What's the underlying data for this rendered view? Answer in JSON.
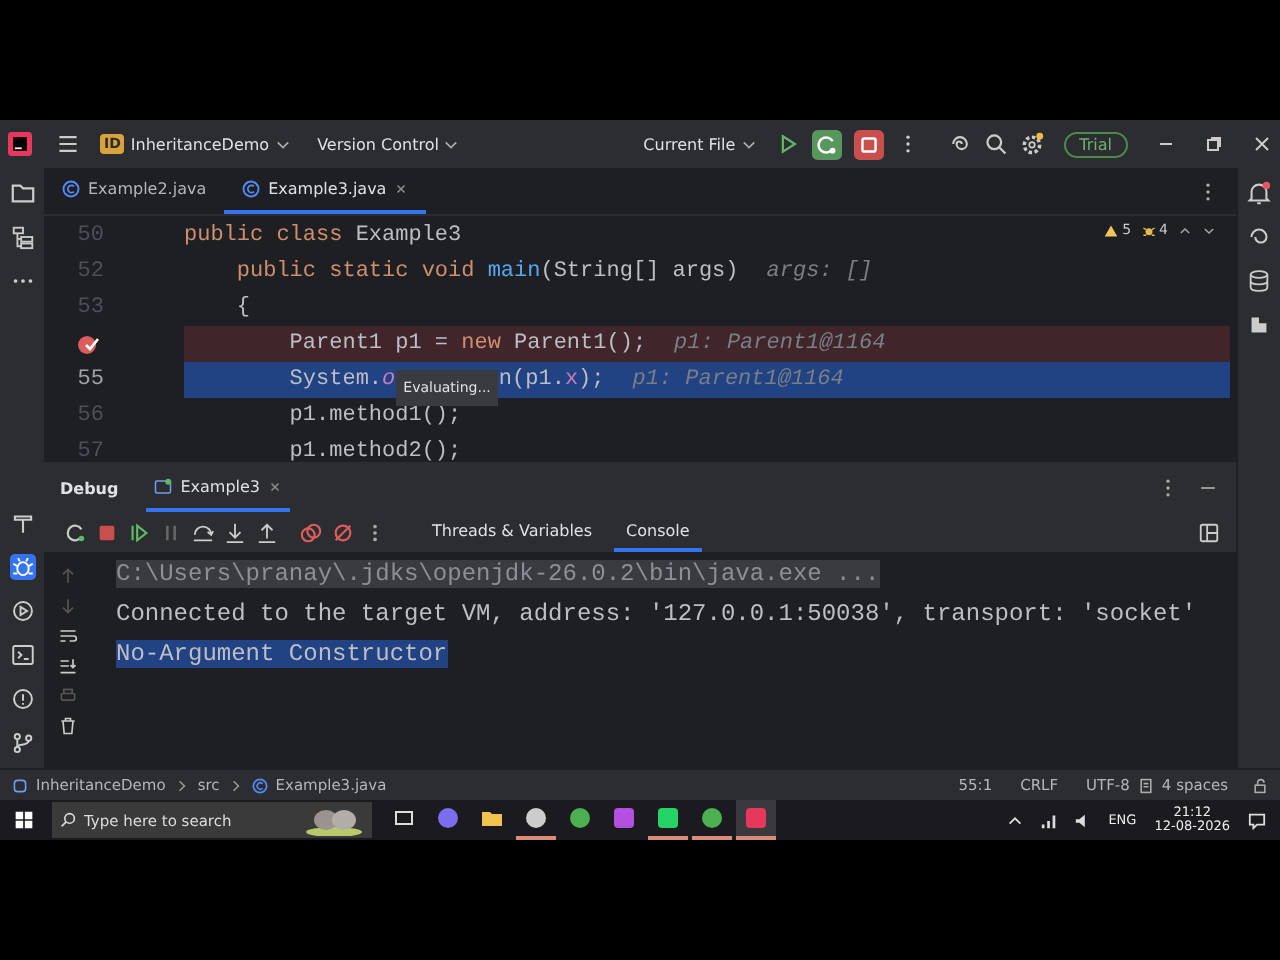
{
  "title_bar": {
    "project_badge": "ID",
    "project": "InheritanceDemo",
    "version_control": "Version Control",
    "run_config": "Current File",
    "trial": "Trial"
  },
  "editor_tabs": [
    {
      "label": "Example2.java",
      "selected": false
    },
    {
      "label": "Example3.java",
      "selected": true
    }
  ],
  "inspections": {
    "warnings": "5",
    "weak_warnings": "4"
  },
  "code_lines": [
    {
      "number": "50",
      "breakpoint": false,
      "current": false,
      "tokens": [
        {
          "kind": "keyword",
          "text": "public class "
        },
        {
          "kind": "plain",
          "text": "Example3"
        }
      ]
    },
    {
      "number": "52",
      "breakpoint": false,
      "current": false,
      "tokens": [
        {
          "kind": "keyword",
          "text": "    public static void "
        },
        {
          "kind": "method",
          "text": "main"
        },
        {
          "kind": "plain",
          "text": "(String[] args)"
        },
        {
          "kind": "hint",
          "text": "args: []"
        }
      ]
    },
    {
      "number": "53",
      "breakpoint": false,
      "current": false,
      "tokens": [
        {
          "kind": "plain",
          "text": "    {"
        }
      ]
    },
    {
      "breakpoint": true,
      "current": false,
      "tokens": [
        {
          "kind": "plain",
          "text": "        Parent1 p1 = "
        },
        {
          "kind": "keyword",
          "text": "new "
        },
        {
          "kind": "plain",
          "text": "Parent1();"
        },
        {
          "kind": "hint",
          "text": "p1: Parent1@1164"
        }
      ]
    },
    {
      "number": "55",
      "breakpoint": false,
      "current": true,
      "tokens": [
        {
          "kind": "plain",
          "text": "        System."
        },
        {
          "kind": "static",
          "text": "o"
        },
        {
          "kind": "tooltip",
          "text": "Evaluating..."
        },
        {
          "kind": "plain",
          "text": "n(p1."
        },
        {
          "kind": "field",
          "text": "x"
        },
        {
          "kind": "plain",
          "text": ");"
        },
        {
          "kind": "hint",
          "text": "p1: Parent1@1164"
        }
      ]
    },
    {
      "number": "56",
      "breakpoint": false,
      "current": false,
      "tokens": [
        {
          "kind": "plain",
          "text": "        p1.method1();"
        }
      ]
    },
    {
      "number": "57",
      "breakpoint": false,
      "current": false,
      "tokens": [
        {
          "kind": "plain",
          "text": "        p1.method2();"
        }
      ]
    }
  ],
  "debug": {
    "title": "Debug",
    "tabs": [
      {
        "label": "Example3",
        "selected": true
      }
    ],
    "views": [
      {
        "label": "Threads & Variables",
        "selected": false
      },
      {
        "label": "Console",
        "selected": true
      }
    ],
    "console_lines": [
      {
        "kind": "command",
        "selected": false,
        "text": "C:\\Users\\pranay\\.jdks\\openjdk-26.0.2\\bin\\java.exe ..."
      },
      {
        "kind": "output",
        "selected": false,
        "text": "Connected to the target VM, address: '127.0.0.1:50038', transport: 'socket'"
      },
      {
        "kind": "output",
        "selected": true,
        "text": "No-Argument Constructor"
      }
    ]
  },
  "left_tools": [
    {
      "kind": "build",
      "selected": false
    },
    {
      "kind": "debug",
      "selected": true
    },
    {
      "kind": "run",
      "selected": false
    },
    {
      "kind": "terminal",
      "selected": false
    },
    {
      "kind": "problems",
      "selected": false
    },
    {
      "kind": "git",
      "selected": false
    }
  ],
  "status_bar": {
    "breadcrumbs": [
      "InheritanceDemo",
      "src",
      "Example3.java"
    ],
    "position": "55:1",
    "line_separator": "CRLF",
    "encoding": "UTF-8",
    "indent": "4 spaces"
  },
  "taskbar": {
    "search_placeholder": "Type here to search",
    "apps": [
      {
        "kind": "task-view",
        "running": false,
        "active": false
      },
      {
        "kind": "copilot",
        "running": false,
        "active": false
      },
      {
        "kind": "folder",
        "running": false,
        "active": false
      },
      {
        "kind": "recorder",
        "running": true,
        "active": false
      },
      {
        "kind": "chrome",
        "running": false,
        "active": false
      },
      {
        "kind": "datagrip",
        "running": false,
        "active": false
      },
      {
        "kind": "whatsapp",
        "running": true,
        "active": false
      },
      {
        "kind": "chrome",
        "running": true,
        "active": false
      },
      {
        "kind": "intellij",
        "running": true,
        "active": true
      }
    ],
    "language": "ENG",
    "time": "21:12",
    "date": "12-08-2026"
  }
}
